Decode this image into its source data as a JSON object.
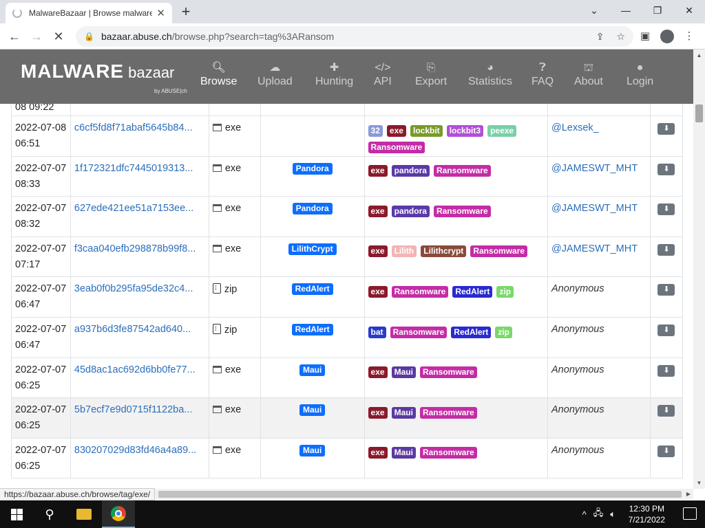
{
  "browser": {
    "tab_title": "MalwareBazaar | Browse malware",
    "tab_close": "✕",
    "new_tab": "+",
    "url_host": "bazaar.abuse.ch",
    "url_path": "/browse.php?search=tag%3ARansom",
    "status_url": "https://bazaar.abuse.ch/browse/tag/exe/"
  },
  "site": {
    "logo_main": "MALWARE",
    "logo_sub": "bazaar",
    "logo_by": "by ABUSE|ch",
    "nav": [
      {
        "label": "Browse",
        "icon": "search-icon"
      },
      {
        "label": "Upload",
        "icon": "cloud-upload-icon"
      },
      {
        "label": "Hunting",
        "icon": "puzzle-icon"
      },
      {
        "label": "API",
        "icon": "code-icon"
      },
      {
        "label": "Export",
        "icon": "file-export-icon"
      },
      {
        "label": "Statistics",
        "icon": "pie-chart-icon"
      },
      {
        "label": "FAQ",
        "icon": "question-icon"
      },
      {
        "label": "About",
        "icon": "building-icon"
      },
      {
        "label": "Login",
        "icon": "user-icon"
      }
    ]
  },
  "table": {
    "partial_top_date": "08 09:22",
    "rows": [
      {
        "date": "2022-07-08 06:51",
        "sha": "c6cf5fd8f71abaf5645b84...",
        "type": "exe",
        "signature": "",
        "tags": [
          "32",
          "exe",
          "lockbit",
          "lockbit3",
          "peexe",
          "Ransomware"
        ],
        "reporter": "@Lexsek_",
        "anon": false
      },
      {
        "date": "2022-07-07 08:33",
        "sha": "1f172321dfc7445019313...",
        "type": "exe",
        "signature": "Pandora",
        "tags": [
          "exe",
          "pandora",
          "Ransomware"
        ],
        "reporter": "@JAMESWT_MHT",
        "anon": false
      },
      {
        "date": "2022-07-07 08:32",
        "sha": "627ede421ee51a7153ee...",
        "type": "exe",
        "signature": "Pandora",
        "tags": [
          "exe",
          "pandora",
          "Ransomware"
        ],
        "reporter": "@JAMESWT_MHT",
        "anon": false
      },
      {
        "date": "2022-07-07 07:17",
        "sha": "f3caa040efb298878b99f8...",
        "type": "exe",
        "signature": "LilithCrypt",
        "tags": [
          "exe",
          "Lilith",
          "Lilithcrypt",
          "Ransomware"
        ],
        "reporter": "@JAMESWT_MHT",
        "anon": false
      },
      {
        "date": "2022-07-07 06:47",
        "sha": "3eab0f0b295fa95de32c4...",
        "type": "zip",
        "signature": "RedAlert",
        "tags": [
          "exe",
          "Ransomware",
          "RedAlert",
          "zip"
        ],
        "reporter": "Anonymous",
        "anon": true
      },
      {
        "date": "2022-07-07 06:47",
        "sha": "a937b6d3fe87542ad640...",
        "type": "zip",
        "signature": "RedAlert",
        "tags": [
          "bat",
          "Ransomware",
          "RedAlert",
          "zip"
        ],
        "reporter": "Anonymous",
        "anon": true
      },
      {
        "date": "2022-07-07 06:25",
        "sha": "45d8ac1ac692d6bb0fe77...",
        "type": "exe",
        "signature": "Maui",
        "tags": [
          "exe",
          "Maui",
          "Ransomware"
        ],
        "reporter": "Anonymous",
        "anon": true
      },
      {
        "date": "2022-07-07 06:25",
        "sha": "5b7ecf7e9d0715f1122ba...",
        "type": "exe",
        "signature": "Maui",
        "tags": [
          "exe",
          "Maui",
          "Ransomware"
        ],
        "reporter": "Anonymous",
        "anon": true,
        "highlight": true
      },
      {
        "date": "2022-07-07 06:25",
        "sha": "830207029d83fd46a4a89...",
        "type": "exe",
        "signature": "Maui",
        "tags": [
          "exe",
          "Maui",
          "Ransomware"
        ],
        "reporter": "Anonymous",
        "anon": true
      }
    ]
  },
  "tag_colors": {
    "32": "#8a9ad8",
    "exe": "#8b1a2c",
    "lockbit": "#7a9a2a",
    "lockbit3": "#b24fd8",
    "peexe": "#78d0a8",
    "Ransomware": "#c42ca6",
    "pandora": "#5a3aa8",
    "Lilith": "#f2b4b4",
    "Lilithcrypt": "#8a4a3a",
    "RedAlert": "#2a2ad0",
    "zip": "#7ad86a",
    "bat": "#2a3ac8",
    "Maui": "#5a3aa0"
  },
  "taskbar": {
    "time": "12:30 PM",
    "date": "7/21/2022"
  }
}
